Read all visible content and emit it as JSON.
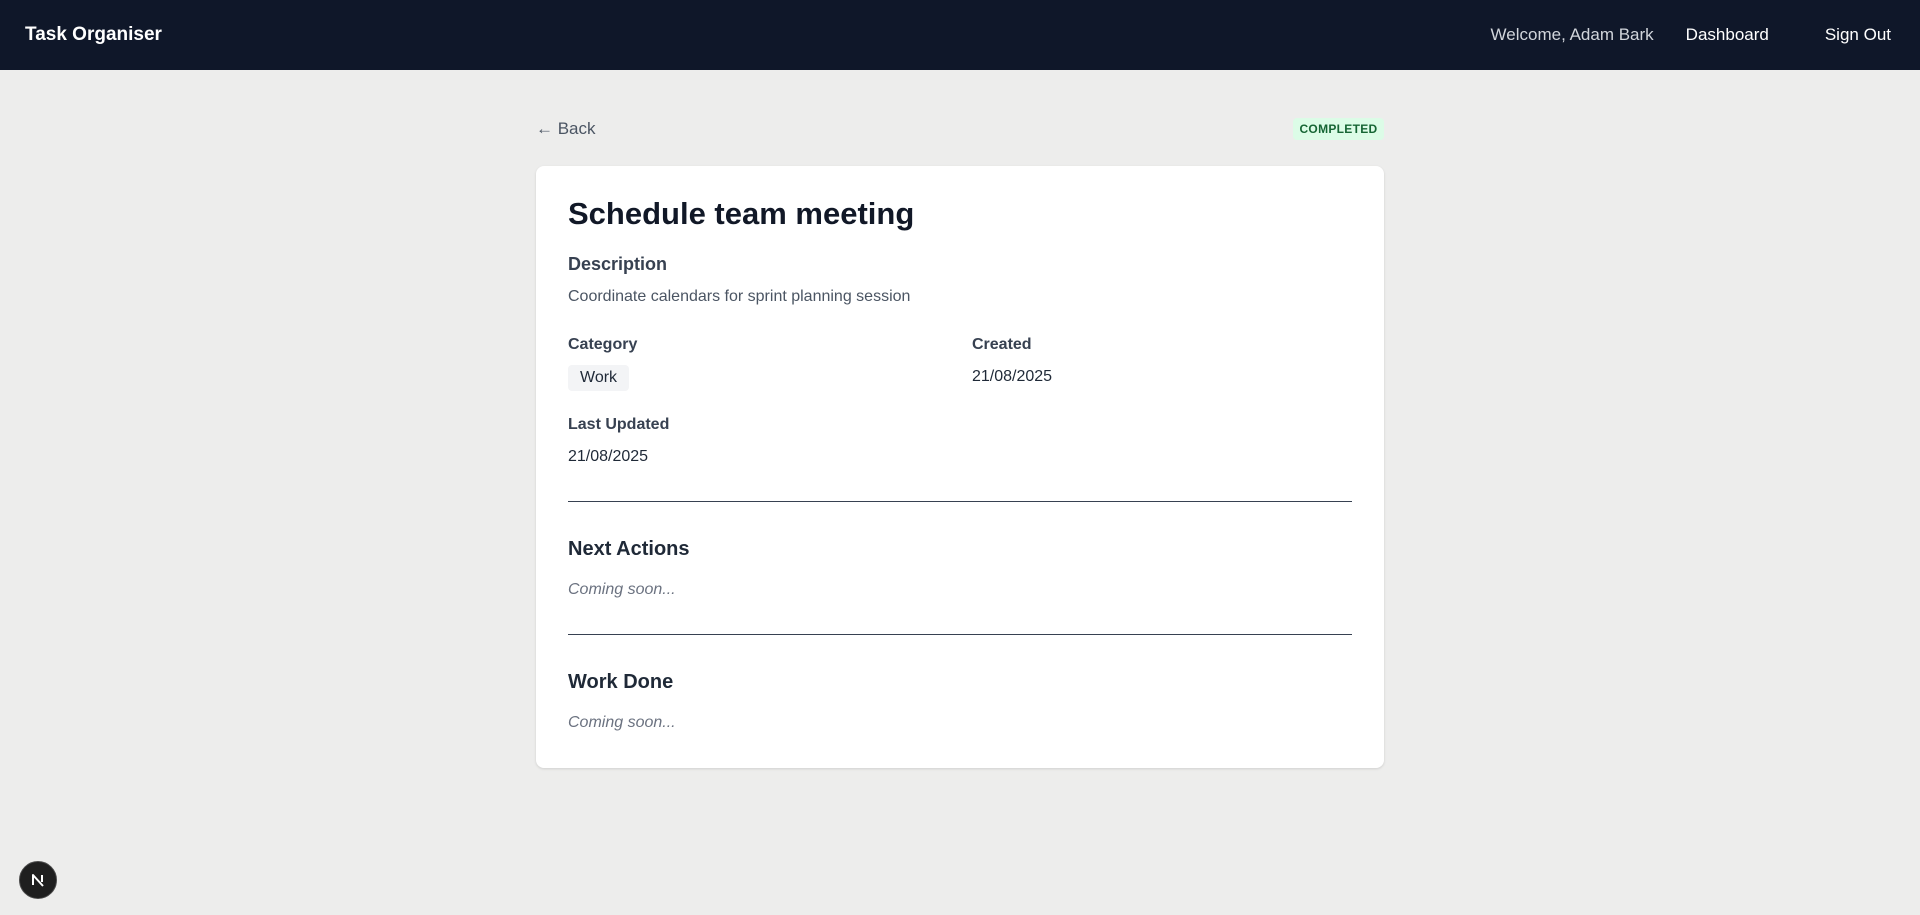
{
  "header": {
    "brand": "Task Organiser",
    "welcome": "Welcome, Adam Bark",
    "dashboard": "Dashboard",
    "sign_out": "Sign Out"
  },
  "back_link": "← Back",
  "status": "COMPLETED",
  "task": {
    "title": "Schedule team meeting",
    "description_label": "Description",
    "description": "Coordinate calendars for sprint planning session",
    "category_label": "Category",
    "category": "Work",
    "created_label": "Created",
    "created": "21/08/2025",
    "updated_label": "Last Updated",
    "updated": "21/08/2025"
  },
  "sections": {
    "next_actions": {
      "title": "Next Actions",
      "placeholder": "Coming soon..."
    },
    "work_done": {
      "title": "Work Done",
      "placeholder": "Coming soon..."
    }
  },
  "colors": {
    "topbar": "#0f1729",
    "page_bg": "#ededec",
    "badge_bg": "#dcfce7",
    "badge_text": "#166534"
  },
  "icons": {
    "dev_badge": "nextjs-logo-icon"
  }
}
